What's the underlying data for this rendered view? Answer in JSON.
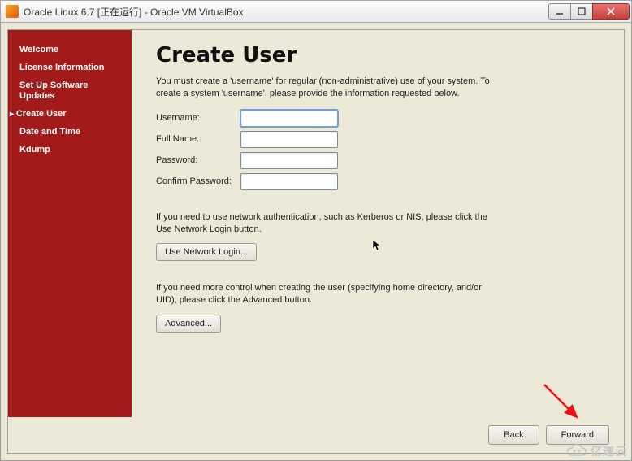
{
  "window": {
    "title": "Oracle Linux 6.7 [正在运行] - Oracle VM VirtualBox"
  },
  "sidebar": {
    "items": [
      {
        "label": "Welcome",
        "current": false
      },
      {
        "label": "License Information",
        "current": false
      },
      {
        "label": "Set Up Software Updates",
        "current": false
      },
      {
        "label": "Create User",
        "current": true
      },
      {
        "label": "Date and Time",
        "current": false
      },
      {
        "label": "Kdump",
        "current": false
      }
    ]
  },
  "page": {
    "title": "Create User",
    "intro": "You must create a 'username' for regular (non-administrative) use of your system.  To create a system 'username', please provide the information requested below.",
    "form": {
      "username_label": "Username:",
      "fullname_label": "Full Name:",
      "password_label": "Password:",
      "confirm_label": "Confirm Password:",
      "username_value": "",
      "fullname_value": "",
      "password_value": "",
      "confirm_value": ""
    },
    "network_para": "If you need to use network authentication, such as Kerberos or NIS, please click the Use Network Login button.",
    "network_button": "Use Network Login...",
    "advanced_para": "If you need more control when creating the user (specifying home directory, and/or UID), please click the Advanced button.",
    "advanced_button": "Advanced..."
  },
  "footer": {
    "back": "Back",
    "forward": "Forward"
  },
  "watermark": "亿速云"
}
